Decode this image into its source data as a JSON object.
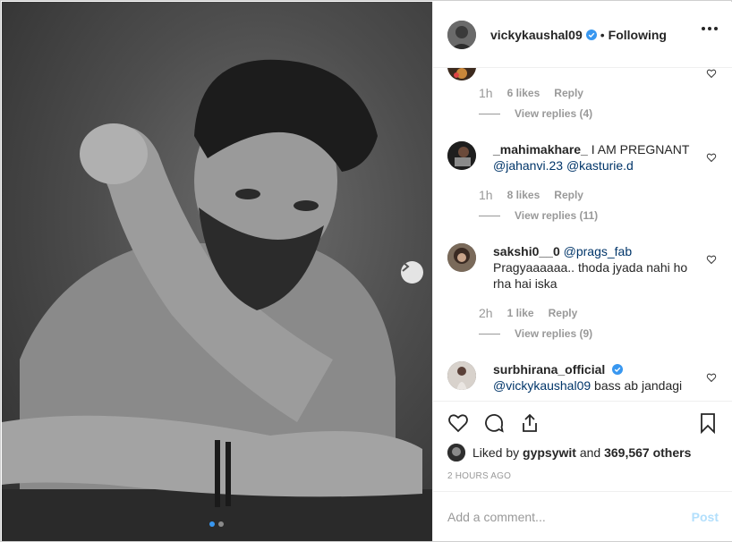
{
  "post": {
    "author": "vickykaushal09",
    "verified": true,
    "separator": "•",
    "follow_state": "Following",
    "carousel": {
      "total": 2,
      "active": 1
    }
  },
  "comments": [
    {
      "user": "",
      "text": "",
      "time": "1h",
      "likes": "6 likes",
      "reply": "Reply",
      "view_replies": "View replies (4)"
    },
    {
      "user": "_mahimakhare_",
      "text": "I AM PREGNANT",
      "mentions": [
        "@jahanvi.23",
        "@kasturie.d"
      ],
      "time": "1h",
      "likes": "8 likes",
      "reply": "Reply",
      "view_replies": "View replies (11)"
    },
    {
      "user": "sakshi0__0",
      "mention": "@prags_fab",
      "text": "Pragyaaaaaa.. thoda jyada nahi ho rha hai iska",
      "time": "2h",
      "likes": "1 like",
      "reply": "Reply",
      "view_replies": "View replies (9)"
    },
    {
      "user": "surbhirana_official",
      "verified": true,
      "mention": "@vickykaushal09",
      "text": "bass ab jandagi"
    }
  ],
  "actions": {
    "icons": [
      "heart-icon",
      "comment-icon",
      "share-icon",
      "bookmark-icon"
    ],
    "liked_by_prefix": "Liked by",
    "liked_by_user": "gypsywit",
    "liked_by_and": "and",
    "liked_by_others": "369,567 others",
    "timestamp": "2 HOURS AGO"
  },
  "add_comment": {
    "placeholder": "Add a comment...",
    "post_label": "Post"
  },
  "colors": {
    "verified": "#3897f0",
    "mention": "#003569",
    "muted": "#999999",
    "post_disabled": "#b2dffc"
  }
}
